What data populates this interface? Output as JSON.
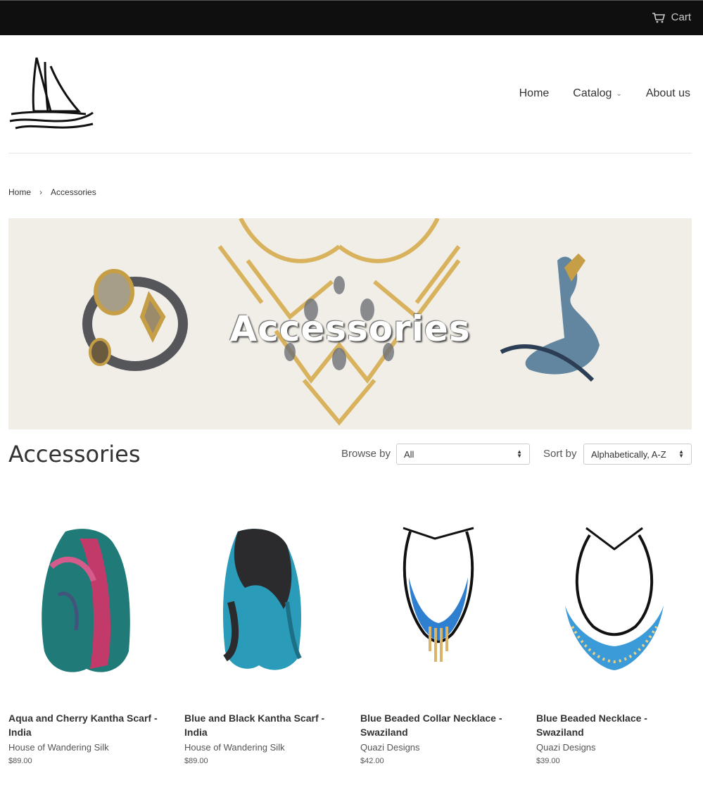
{
  "topbar": {
    "cart_label": "Cart"
  },
  "nav": {
    "home": "Home",
    "catalog": "Catalog",
    "about": "About us"
  },
  "breadcrumb": {
    "home": "Home",
    "separator": "›",
    "current": "Accessories"
  },
  "hero": {
    "title": "Accessories"
  },
  "collection": {
    "title": "Accessories",
    "browse_label": "Browse by",
    "browse_value": "All",
    "sort_label": "Sort by",
    "sort_value": "Alphabetically, A-Z"
  },
  "products": [
    {
      "name": "Aqua and Cherry Kantha Scarf - India",
      "vendor": "House of Wandering Silk",
      "price": "$89.00"
    },
    {
      "name": "Blue and Black Kantha Scarf - India",
      "vendor": "House of Wandering Silk",
      "price": "$89.00"
    },
    {
      "name": "Blue Beaded Collar Necklace - Swaziland",
      "vendor": "Quazi Designs",
      "price": "$42.00"
    },
    {
      "name": "Blue Beaded Necklace - Swaziland",
      "vendor": "Quazi Designs",
      "price": "$39.00"
    }
  ]
}
